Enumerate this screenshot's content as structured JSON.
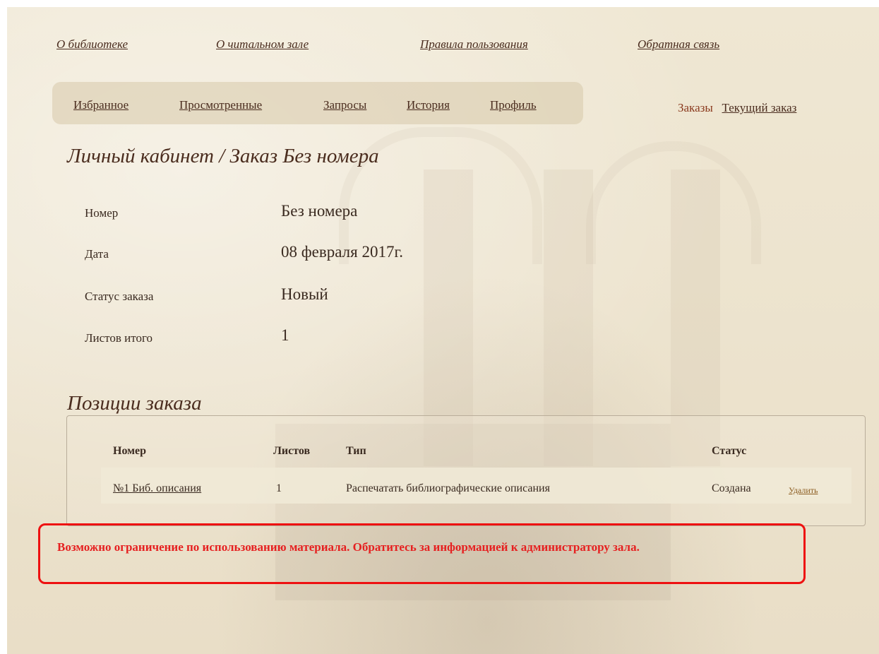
{
  "top_nav": {
    "about_library": "О библиотеке",
    "about_reading_room": "О читальном зале",
    "usage_rules": "Правила пользования",
    "feedback": "Обратная связь"
  },
  "sub_nav": {
    "favorites": "Избранное",
    "viewed": "Просмотренные",
    "requests": "Запросы",
    "history": "История",
    "profile": "Профиль"
  },
  "right_nav": {
    "orders": "Заказы",
    "current_order": "Текущий заказ"
  },
  "page_title": "Личный кабинет / Заказ Без номера",
  "order_info": {
    "number_label": "Номер",
    "number_value": "Без номера",
    "date_label": "Дата",
    "date_value": "08 февраля 2017г.",
    "status_label": "Статус заказа",
    "status_value": "Новый",
    "sheets_label": "Листов итого",
    "sheets_value": "1"
  },
  "positions": {
    "title": "Позиции заказа",
    "headers": {
      "number": "Номер",
      "sheets": "Листов",
      "type": "Тип",
      "status": "Статус"
    },
    "rows": [
      {
        "number": "№1 Биб. описания",
        "sheets": "1",
        "type": "Распечатать библиографические описания",
        "status": "Создана",
        "delete_label": "Удалить"
      }
    ]
  },
  "warning": "Возможно ограничение по использованию материала. Обратитесь за информацией к администратору зала.",
  "colors": {
    "link": "#4a2c1e",
    "warning": "#e62020",
    "background": "#ede4cf"
  }
}
